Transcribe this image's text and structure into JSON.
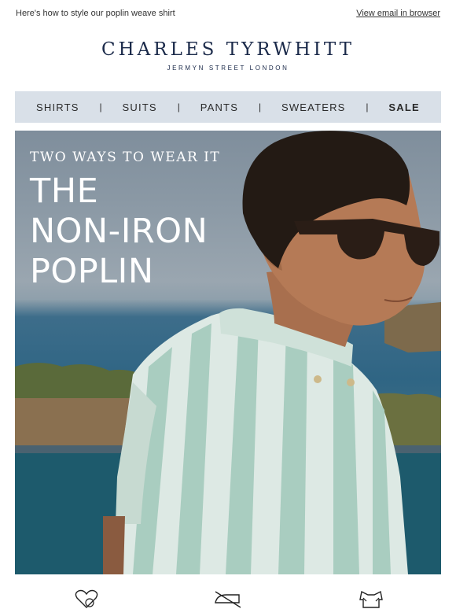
{
  "preheader": {
    "text": "Here's how to style our poplin weave shirt",
    "view_link": "View email in browser"
  },
  "logo": {
    "brand": "CHARLES TYRWHITT",
    "sub": "JERMYN STREET LONDON"
  },
  "nav": {
    "items": [
      "SHIRTS",
      "SUITS",
      "PANTS",
      "SWEATERS",
      "SALE"
    ],
    "separator": "|"
  },
  "hero": {
    "kicker": "TWO WAYS TO WEAR IT",
    "headline": [
      "THE",
      "NON-IRON",
      "POPLIN"
    ]
  },
  "bottom_icons": [
    "care-heart-icon",
    "no-iron-icon",
    "stretch-fit-icon"
  ]
}
